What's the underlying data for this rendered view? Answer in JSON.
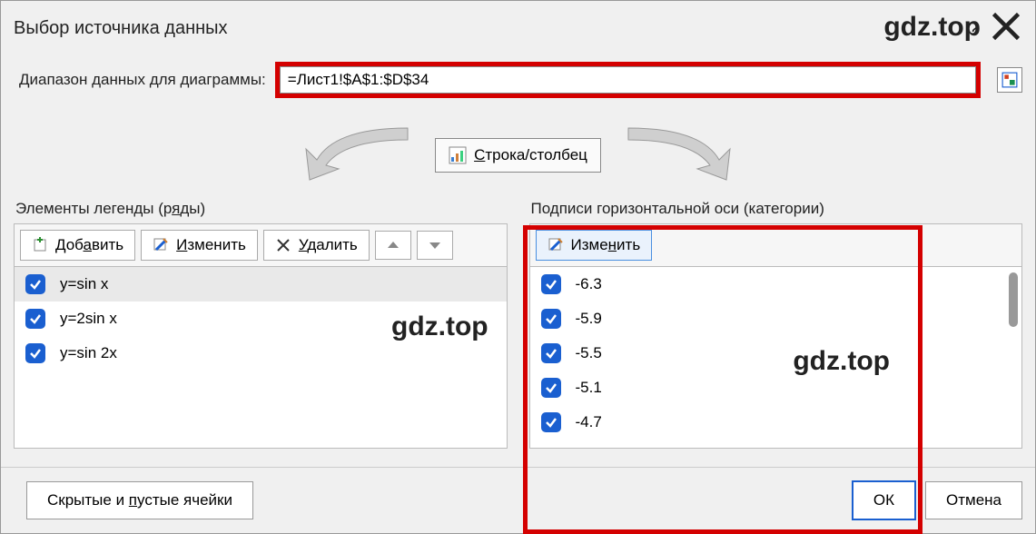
{
  "title": "Выбор источника данных",
  "watermark": "gdz.top",
  "range_label": "Диапазон данных для диаграммы:",
  "range_value": "=Лист1!$A$1:$D$34",
  "row_col_btn": "Строка/столбец",
  "panel_left": {
    "title": "Элементы легенды (ряды)",
    "btn_add": "Добавить",
    "btn_edit": "Изменить",
    "btn_delete": "Удалить",
    "items": [
      {
        "label": "y=sin x"
      },
      {
        "label": "y=2sin x"
      },
      {
        "label": "y=sin 2x"
      }
    ]
  },
  "panel_right": {
    "title": "Подписи горизонтальной оси (категории)",
    "btn_edit": "Изменить",
    "items": [
      {
        "label": "-6.3"
      },
      {
        "label": "-5.9"
      },
      {
        "label": "-5.5"
      },
      {
        "label": "-5.1"
      },
      {
        "label": "-4.7"
      }
    ]
  },
  "footer": {
    "hidden_cells": "Скрытые и пустые ячейки",
    "ok": "ОК",
    "cancel": "Отмена"
  }
}
